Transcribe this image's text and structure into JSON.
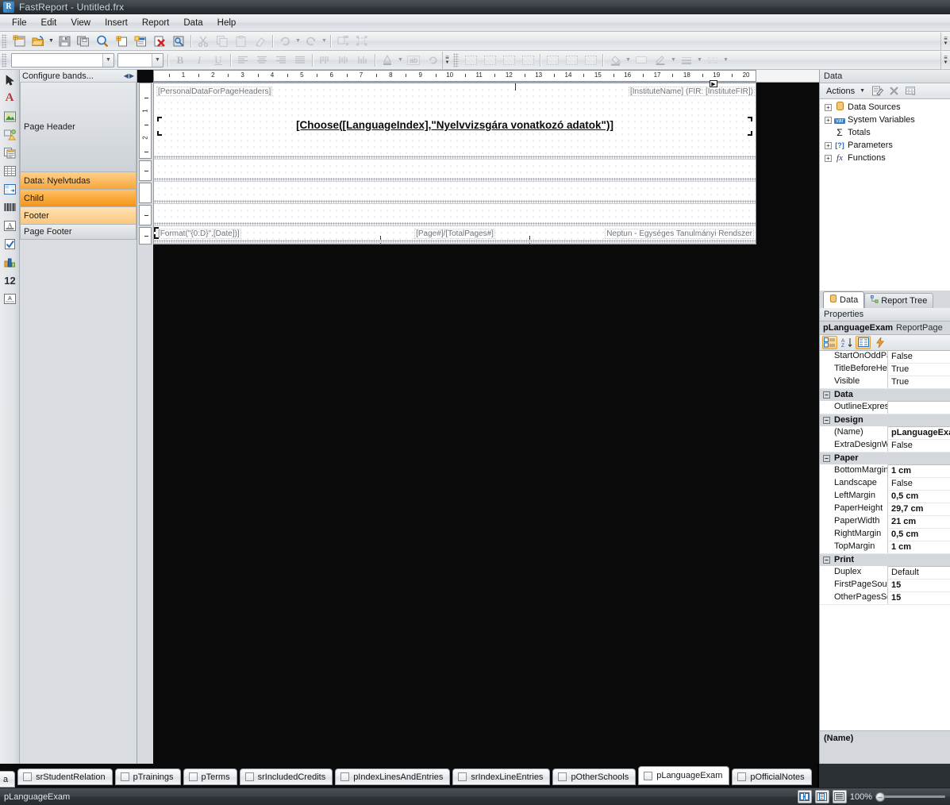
{
  "window": {
    "title": "FastReport - Untitled.frx",
    "app_icon": "fastreport-logo-icon"
  },
  "menu": {
    "items": [
      "File",
      "Edit",
      "View",
      "Insert",
      "Report",
      "Data",
      "Help"
    ]
  },
  "standard_toolbar": {
    "buttons": [
      {
        "name": "new-report-button",
        "glyph": "▦",
        "enabled": true
      },
      {
        "name": "open-report-button",
        "glyph": "📂",
        "enabled": true
      },
      {
        "name": "open-dropdown-caret",
        "glyph": "▾",
        "enabled": true
      },
      {
        "name": "save-report-button",
        "glyph": "💾",
        "enabled": true
      },
      {
        "name": "save-all-button",
        "glyph": "🗎",
        "enabled": true
      },
      {
        "name": "preview-button",
        "glyph": "🔍",
        "enabled": true
      },
      {
        "name": "new-page-button",
        "glyph": "▯",
        "enabled": true
      },
      {
        "name": "new-dialog-button",
        "glyph": "▤",
        "enabled": true
      },
      {
        "name": "delete-page-button",
        "glyph": "✖",
        "enabled": true
      },
      {
        "name": "page-settings-button",
        "glyph": "⚙",
        "enabled": true
      },
      {
        "name": "cut-button",
        "glyph": "✂",
        "enabled": false
      },
      {
        "name": "copy-button",
        "glyph": "⧉",
        "enabled": false
      },
      {
        "name": "paste-button",
        "glyph": "📋",
        "enabled": false
      },
      {
        "name": "format-painter-button",
        "glyph": "🖌",
        "enabled": false
      },
      {
        "name": "undo-button",
        "glyph": "↶",
        "enabled": false
      },
      {
        "name": "undo-dropdown-caret",
        "glyph": "▾",
        "enabled": false
      },
      {
        "name": "redo-button",
        "glyph": "↷",
        "enabled": false
      },
      {
        "name": "redo-dropdown-caret",
        "glyph": "▾",
        "enabled": false
      },
      {
        "name": "group-button",
        "glyph": "⧈",
        "enabled": false
      },
      {
        "name": "ungroup-button",
        "glyph": "⬚",
        "enabled": false
      }
    ],
    "overflow_label": "toolbar-overflow-button"
  },
  "format_toolbar": {
    "font_name_value": "",
    "font_name_placeholder": "",
    "font_size_value": "",
    "buttons": [
      {
        "name": "bold-button",
        "glyph": "B",
        "enabled": false
      },
      {
        "name": "italic-button",
        "glyph": "I",
        "enabled": false
      },
      {
        "name": "underline-button",
        "glyph": "U",
        "enabled": false
      },
      {
        "name": "align-left-button",
        "glyph": "≣",
        "enabled": false
      },
      {
        "name": "align-center-button",
        "glyph": "≣",
        "enabled": false
      },
      {
        "name": "align-right-button",
        "glyph": "≣",
        "enabled": false
      },
      {
        "name": "align-justify-button",
        "glyph": "≣",
        "enabled": false
      },
      {
        "name": "align-top-button",
        "glyph": "⦀",
        "enabled": false
      },
      {
        "name": "align-middle-button",
        "glyph": "⦀",
        "enabled": false
      },
      {
        "name": "align-bottom-button",
        "glyph": "⦀",
        "enabled": false
      },
      {
        "name": "font-color-button",
        "glyph": "A",
        "enabled": false
      },
      {
        "name": "font-color-caret",
        "glyph": "▾",
        "enabled": false
      },
      {
        "name": "text-rotation-button",
        "glyph": "ab",
        "enabled": false
      },
      {
        "name": "reset-format-button",
        "glyph": "↺",
        "enabled": false
      }
    ]
  },
  "border_toolbar": {
    "buttons": [
      {
        "name": "border-all-button",
        "glyph": "▦",
        "enabled": false
      },
      {
        "name": "border-none-button",
        "glyph": "▦",
        "enabled": false
      },
      {
        "name": "border-outline-button",
        "glyph": "▦",
        "enabled": false
      },
      {
        "name": "border-inside-button",
        "glyph": "▦",
        "enabled": false
      },
      {
        "name": "border-top-button",
        "glyph": "▤",
        "enabled": false
      },
      {
        "name": "border-bottom-button",
        "glyph": "▦",
        "enabled": false
      },
      {
        "name": "border-shadow-button",
        "glyph": "▨",
        "enabled": false
      },
      {
        "name": "fill-color-button",
        "glyph": "🪣",
        "enabled": false
      },
      {
        "name": "fill-color-caret",
        "glyph": "▾",
        "enabled": false
      },
      {
        "name": "no-fill-button",
        "glyph": "▭",
        "enabled": false
      },
      {
        "name": "line-color-button",
        "glyph": "✏",
        "enabled": false
      },
      {
        "name": "line-color-caret",
        "glyph": "▾",
        "enabled": false
      },
      {
        "name": "line-width-button",
        "glyph": "≡",
        "enabled": false
      },
      {
        "name": "line-width-caret",
        "glyph": "▾",
        "enabled": false
      },
      {
        "name": "line-style-button",
        "glyph": "⋯",
        "enabled": false
      },
      {
        "name": "line-style-caret",
        "glyph": "▾",
        "enabled": false
      }
    ]
  },
  "tool_palette": {
    "tools": [
      {
        "name": "select-tool",
        "glyph": "arrow",
        "label": "Select"
      },
      {
        "name": "text-object-tool",
        "glyph": "A",
        "label": "Text"
      },
      {
        "name": "picture-object-tool",
        "glyph": "picture",
        "label": "Picture"
      },
      {
        "name": "shape-object-tool",
        "glyph": "shape",
        "label": "Shape"
      },
      {
        "name": "subreport-object-tool",
        "glyph": "subreport",
        "label": "Subreport"
      },
      {
        "name": "table-object-tool",
        "glyph": "table",
        "label": "Table"
      },
      {
        "name": "matrix-object-tool",
        "glyph": "matrix",
        "label": "Matrix"
      },
      {
        "name": "barcode-object-tool",
        "glyph": "barcode",
        "label": "Barcode"
      },
      {
        "name": "richtext-object-tool",
        "glyph": "richtext",
        "label": "Rich Text"
      },
      {
        "name": "checkbox-object-tool",
        "glyph": "checkbox",
        "label": "CheckBox"
      },
      {
        "name": "chart-object-tool",
        "glyph": "chart",
        "label": "Chart"
      },
      {
        "name": "digital-object-tool",
        "glyph": "12",
        "label": "Digital"
      },
      {
        "name": "zipcode-object-tool",
        "glyph": "zipcode",
        "label": "ZipCode"
      }
    ]
  },
  "bands_panel": {
    "header": "Configure bands...",
    "nav_left_icon": "chevron-left-icon",
    "nav_right_icon": "chevron-right-icon",
    "bands": [
      {
        "label": "Page Header",
        "style": "plain"
      },
      {
        "label": "Data: Nyelvtudas",
        "style": "orange-l"
      },
      {
        "label": "Child",
        "style": "orange-d"
      },
      {
        "label": "Footer",
        "style": "orange-p"
      },
      {
        "label": "Page Footer",
        "style": "plain"
      }
    ]
  },
  "designer": {
    "h_ruler_unit": "cm",
    "h_ruler_ticks": [
      1,
      2,
      3,
      4,
      5,
      6,
      7,
      8,
      9,
      10,
      11,
      12,
      13,
      14,
      15,
      16,
      17,
      18,
      19,
      20
    ],
    "v_ruler_ticks": [
      "1",
      "2"
    ],
    "page_header_objects": [
      {
        "name": "personal-data-text-object",
        "text": "[PersonalDataForPageHeaders]"
      },
      {
        "name": "institute-name-text-object",
        "text": "[InstituteName] (FIR: [InstituteFIR])"
      }
    ],
    "title_object": {
      "name": "report-title-text-object",
      "text": "[Choose([LanguageIndex],\"Nyelvvizsgára vonatkozó adatok\")]"
    },
    "page_footer_objects": [
      {
        "name": "date-text-object",
        "text": "[Format(\"{0:D}\",[Date])]"
      },
      {
        "name": "page-number-text-object",
        "text": "[Page#]/[TotalPages#]"
      },
      {
        "name": "system-name-text-object",
        "text": "Neptun - Egységes Tanulmányi Rendszer"
      }
    ]
  },
  "data_panel": {
    "caption": "Data",
    "actions_label": "Actions",
    "actions_caret": "▾",
    "toolbar_buttons": [
      {
        "name": "edit-datasource-button",
        "glyph": "✎"
      },
      {
        "name": "delete-datasource-button",
        "glyph": "✕"
      },
      {
        "name": "view-data-button",
        "glyph": "▦"
      }
    ],
    "tree": [
      {
        "label": "Data Sources",
        "icon": "database-icon",
        "expandable": true
      },
      {
        "label": "System Variables",
        "icon": "var-icon",
        "expandable": true
      },
      {
        "label": "Totals",
        "icon": "sigma-icon",
        "expandable": false
      },
      {
        "label": "Parameters",
        "icon": "parameter-icon",
        "expandable": true
      },
      {
        "label": "Functions",
        "icon": "function-icon",
        "expandable": true
      }
    ],
    "tabs": [
      {
        "label": "Data",
        "icon": "database-icon",
        "active": true
      },
      {
        "label": "Report Tree",
        "icon": "tree-icon",
        "active": false
      }
    ]
  },
  "properties_panel": {
    "caption": "Properties",
    "object_name": "pLanguageExam",
    "object_type": "ReportPage",
    "toolbar_buttons": [
      {
        "name": "categorized-view-button",
        "glyph": "▤",
        "active": true
      },
      {
        "name": "alphabetical-view-button",
        "glyph": "A↓",
        "active": false
      },
      {
        "name": "properties-view-button",
        "glyph": "▥",
        "active": true
      },
      {
        "name": "events-view-button",
        "glyph": "⚡",
        "active": false
      }
    ],
    "rows": [
      {
        "kind": "prop",
        "name": "StartOnOddPage",
        "value": "False",
        "bold": false
      },
      {
        "kind": "prop",
        "name": "TitleBeforeHeader",
        "value": "True",
        "bold": false
      },
      {
        "kind": "prop",
        "name": "Visible",
        "value": "True",
        "bold": false
      },
      {
        "kind": "category",
        "name": "Data",
        "value": ""
      },
      {
        "kind": "prop",
        "name": "OutlineExpression",
        "value": "",
        "bold": false
      },
      {
        "kind": "category",
        "name": "Design",
        "value": ""
      },
      {
        "kind": "prop",
        "name": "(Name)",
        "value": "pLanguageExam",
        "bold": true
      },
      {
        "kind": "prop",
        "name": "ExtraDesignWidth",
        "value": "False",
        "bold": false
      },
      {
        "kind": "category",
        "name": "Paper",
        "value": ""
      },
      {
        "kind": "prop",
        "name": "BottomMargin",
        "value": "1 cm",
        "bold": true
      },
      {
        "kind": "prop",
        "name": "Landscape",
        "value": "False",
        "bold": false
      },
      {
        "kind": "prop",
        "name": "LeftMargin",
        "value": "0,5 cm",
        "bold": true
      },
      {
        "kind": "prop",
        "name": "PaperHeight",
        "value": "29,7 cm",
        "bold": true
      },
      {
        "kind": "prop",
        "name": "PaperWidth",
        "value": "21 cm",
        "bold": true
      },
      {
        "kind": "prop",
        "name": "RightMargin",
        "value": "0,5 cm",
        "bold": true
      },
      {
        "kind": "prop",
        "name": "TopMargin",
        "value": "1 cm",
        "bold": true
      },
      {
        "kind": "category",
        "name": "Print",
        "value": ""
      },
      {
        "kind": "prop",
        "name": "Duplex",
        "value": "Default",
        "bold": false
      },
      {
        "kind": "prop",
        "name": "FirstPageSource",
        "value": "15",
        "bold": true
      },
      {
        "kind": "prop",
        "name": "OtherPagesSource",
        "value": "15",
        "bold": true
      }
    ],
    "description": "(Name)"
  },
  "page_tabs": {
    "partial_first": "a",
    "items": [
      {
        "label": "srStudentRelation",
        "active": false
      },
      {
        "label": "pTrainings",
        "active": false
      },
      {
        "label": "pTerms",
        "active": false
      },
      {
        "label": "srIncludedCredits",
        "active": false
      },
      {
        "label": "pIndexLinesAndEntries",
        "active": false
      },
      {
        "label": "srIndexLineEntries",
        "active": false
      },
      {
        "label": "pOtherSchools",
        "active": false
      },
      {
        "label": "pLanguageExam",
        "active": true
      },
      {
        "label": "pOfficialNotes",
        "active": false
      }
    ],
    "nav_prev": "◀",
    "nav_next": "▶",
    "nav_close": "✕"
  },
  "statusbar": {
    "text": "pLanguageExam",
    "zoom_label": "100%",
    "view_buttons": [
      {
        "name": "view-two-page-button",
        "glyph": "▤"
      },
      {
        "name": "view-single-page-button",
        "glyph": "▣"
      },
      {
        "name": "view-continuous-button",
        "glyph": "▥"
      }
    ],
    "zoom_out_icon": "zoom-out-icon"
  },
  "colors": {
    "accent_orange": "#f59416",
    "title_bar": "#3c4247",
    "canvas_dark": "#0a0a0a",
    "panel_gray": "#d4d8dd"
  }
}
